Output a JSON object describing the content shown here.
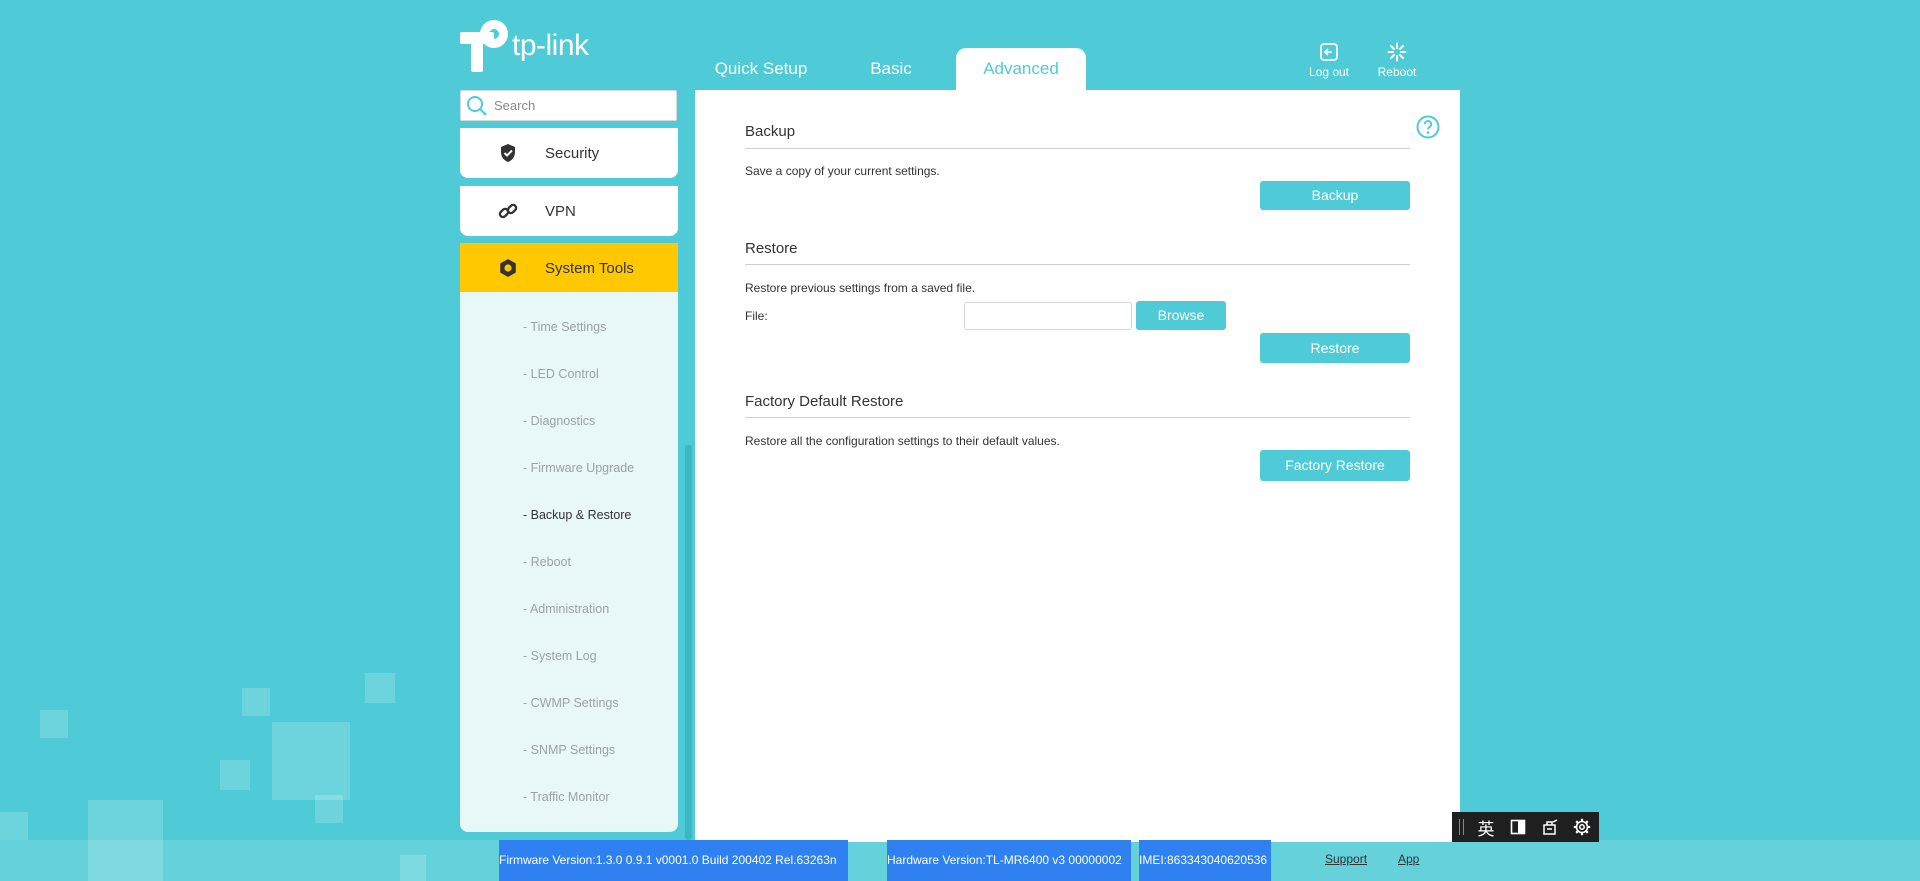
{
  "brand": {
    "logo_text": "tp-link"
  },
  "tabs": [
    {
      "label": "Quick Setup",
      "active": false
    },
    {
      "label": "Basic",
      "active": false
    },
    {
      "label": "Advanced",
      "active": true
    }
  ],
  "top_actions": {
    "logout_label": "Log out",
    "reboot_label": "Reboot"
  },
  "search": {
    "placeholder": "Search",
    "value": ""
  },
  "nav": {
    "items": [
      {
        "label": "Security",
        "icon": "shield-check-icon"
      },
      {
        "label": "VPN",
        "icon": "link-icon"
      },
      {
        "label": "System Tools",
        "icon": "gear-icon",
        "active": true
      }
    ],
    "submenu": [
      "- Time Settings",
      "- LED Control",
      "- Diagnostics",
      "- Firmware Upgrade",
      "- Backup & Restore",
      "- Reboot",
      "- Administration",
      "- System Log",
      "- CWMP Settings",
      "- SNMP Settings",
      "- Traffic Monitor"
    ],
    "submenu_active": "- Backup & Restore"
  },
  "backup": {
    "title": "Backup",
    "description": "Save a copy of your current settings.",
    "button": "Backup"
  },
  "restore": {
    "title": "Restore",
    "description": "Restore previous settings from a saved file.",
    "file_label": "File:",
    "file_value": "",
    "browse_button": "Browse",
    "button": "Restore"
  },
  "factory": {
    "title": "Factory Default Restore",
    "description": "Restore all the configuration settings to their default values.",
    "button": "Factory Restore"
  },
  "footer": {
    "firmware": "Firmware Version:1.3.0 0.9.1 v0001.0 Build 200402 Rel.63263n",
    "hardware": "Hardware Version:TL-MR6400 v3 00000002",
    "imei": "IMEI:863343040620536",
    "support_link": "Support",
    "app_link": "App"
  },
  "ime_toolbar": {
    "lang": "英"
  },
  "colors": {
    "accent": "#4ecbd6",
    "active_nav": "#ffc800",
    "selection_highlight": "#2f80f0"
  }
}
